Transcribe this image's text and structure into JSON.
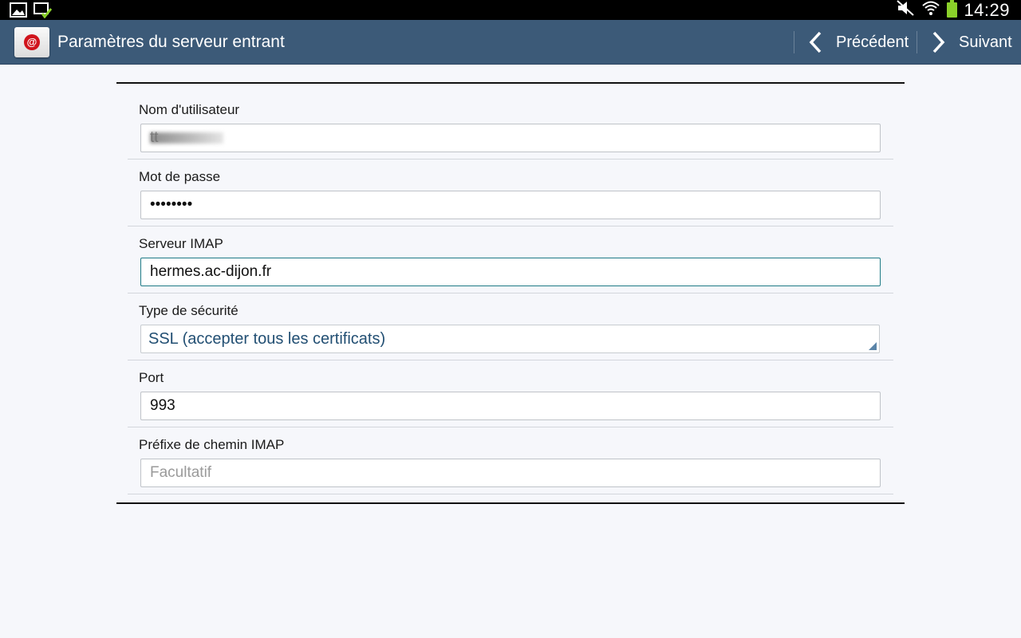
{
  "status_bar": {
    "time": "14:29",
    "icons_left": [
      "picture-notification-icon",
      "screen-mirroring-check-icon"
    ],
    "icons_right": [
      "mute-icon",
      "wifi-icon",
      "battery-icon"
    ],
    "battery_color": "#8bd12a"
  },
  "action_bar": {
    "title": "Paramètres du serveur entrant",
    "app_icon": "email-app-icon",
    "prev_label": "Précédent",
    "next_label": "Suivant",
    "background": "#3c5a78"
  },
  "form": {
    "username": {
      "label": "Nom d'utilisateur",
      "value": "tt"
    },
    "password": {
      "label": "Mot de passe",
      "value": "••••••••"
    },
    "imap_server": {
      "label": "Serveur IMAP",
      "value": "hermes.ac-dijon.fr"
    },
    "security": {
      "label": "Type de sécurité",
      "value": "SSL (accepter tous les certificats)"
    },
    "port": {
      "label": "Port",
      "value": "993"
    },
    "path_prefix": {
      "label": "Préfixe de chemin IMAP",
      "value": "",
      "placeholder": "Facultatif"
    }
  }
}
